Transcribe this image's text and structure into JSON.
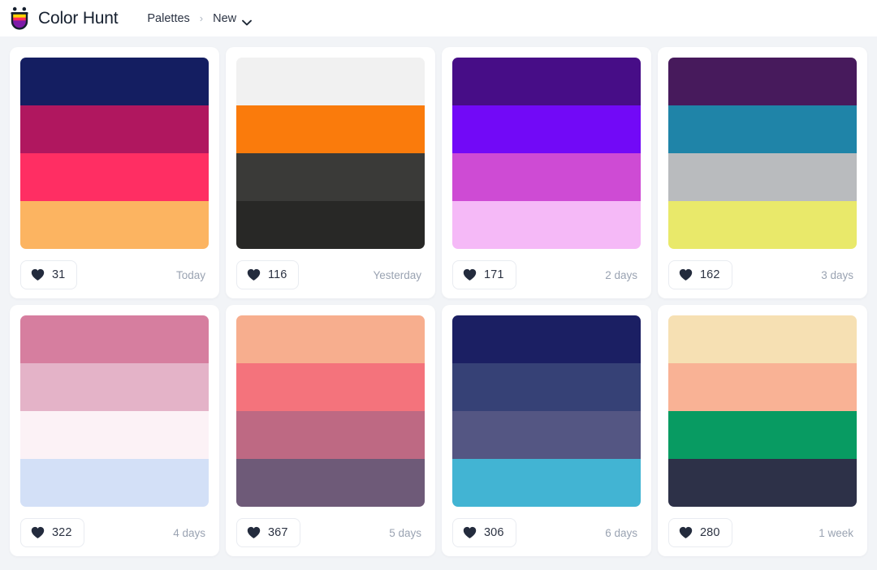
{
  "header": {
    "logo_icon": "colorhunt-shield-logo",
    "logo_colors": [
      "#ffd400",
      "#ff2b5e",
      "#7d1aa8"
    ],
    "brand": "Color Hunt",
    "nav": {
      "palettes_label": "Palettes",
      "separator": "›",
      "current_label": "New",
      "chevron_icon": "chevron-down-icon"
    }
  },
  "palettes": [
    {
      "colors": [
        "#141E61",
        "#B0175F",
        "#FF2E63",
        "#FCB461"
      ],
      "likes": "31",
      "date": "Today"
    },
    {
      "colors": [
        "#F1F1F1",
        "#FA7B0C",
        "#3A3A38",
        "#282826"
      ],
      "likes": "116",
      "date": "Yesterday"
    },
    {
      "colors": [
        "#470D87",
        "#7209F7",
        "#CE4BD4",
        "#F5B9F7"
      ],
      "likes": "171",
      "date": "2 days"
    },
    {
      "colors": [
        "#471A5C",
        "#1F84A8",
        "#B9BBBE",
        "#E9E96A"
      ],
      "likes": "162",
      "date": "3 days"
    },
    {
      "colors": [
        "#D67E9F",
        "#E4B3C8",
        "#FCF2F6",
        "#D3E0F7"
      ],
      "likes": "322",
      "date": "4 days"
    },
    {
      "colors": [
        "#F7AE8E",
        "#F4737C",
        "#BE6983",
        "#6E5A78"
      ],
      "likes": "367",
      "date": "5 days"
    },
    {
      "colors": [
        "#1B1F63",
        "#364176",
        "#545683",
        "#42B4D3"
      ],
      "likes": "306",
      "date": "6 days"
    },
    {
      "colors": [
        "#F6E0B3",
        "#F9B295",
        "#089B62",
        "#2D3148"
      ],
      "likes": "280",
      "date": "1 week"
    }
  ],
  "icons": {
    "heart": "heart-icon"
  }
}
